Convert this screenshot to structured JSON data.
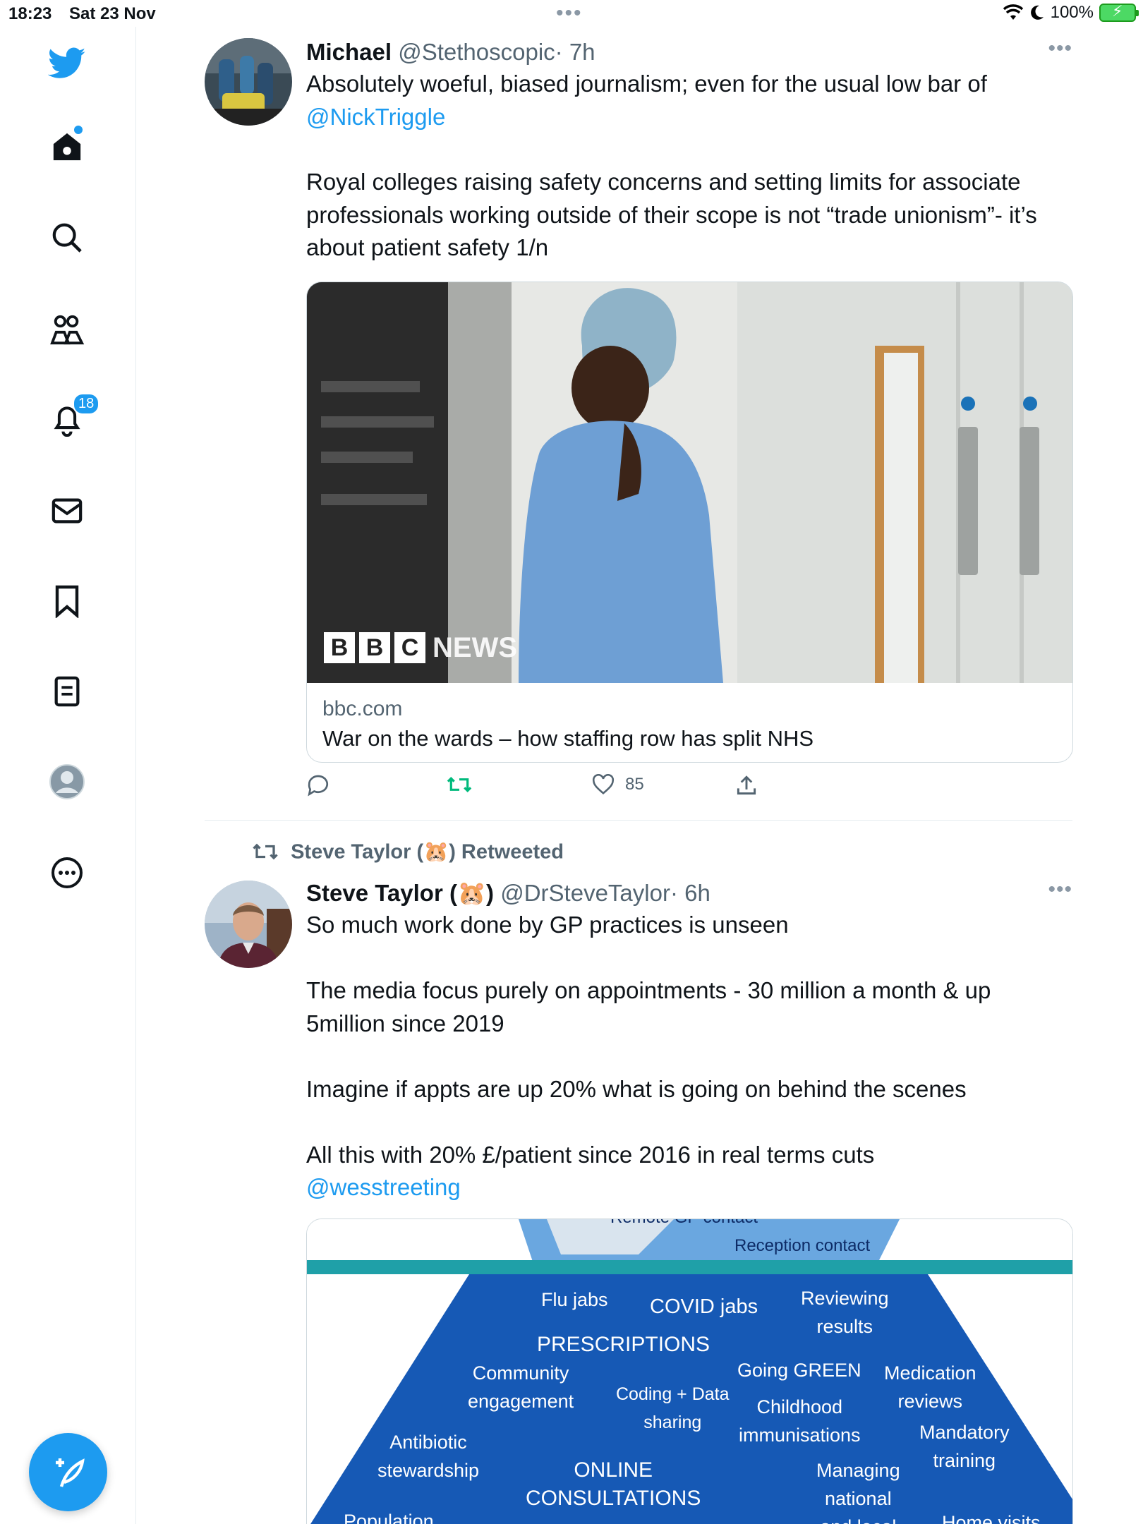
{
  "status_bar": {
    "time": "18:23",
    "date": "Sat 23 Nov",
    "battery": "100%"
  },
  "sidebar": {
    "notifications_count": "18"
  },
  "tweet1": {
    "name": "Michael",
    "handle": "@Stethoscopic",
    "time": "· 7h",
    "text_a": "Absolutely woeful, biased journalism; even for the usual low bar of",
    "mention": "@NickTriggle",
    "text_b": "Royal colleges raising safety concerns and setting limits for associate professionals working outside of their scope is not “trade unionism”- it’s about patient safety 1/n",
    "card": {
      "image_watermark": "NEWS",
      "domain": "bbc.com",
      "title": "War on the wards – how staffing row has split NHS"
    },
    "likes": "85"
  },
  "retweet": {
    "retweeted_by": "Steve Taylor (🐹) Retweeted"
  },
  "tweet2": {
    "name": "Steve Taylor (🐹)",
    "handle": "@DrSteveTaylor",
    "time": "· 6h",
    "text_a": "So much work done by GP practices is unseen\n\nThe media focus purely on appointments - 30 million a month & up 5million since 2019\n\nImagine if appts are up 20% what is going on behind the scenes\n\nAll this with 20% £/patient since 2016 in real terms cuts",
    "mention": "@wesstreeting",
    "iceberg": {
      "top_labels": [
        "Remote GP contact",
        "Reception contact"
      ],
      "labels": [
        "Flu jabs",
        "COVID jabs",
        "Reviewing\nresults",
        "PRESCRIPTIONS",
        "Going GREEN",
        "Medication\nreviews",
        "Community\nengagement",
        "Coding + Data\nsharing",
        "Childhood\nimmunisations",
        "Mandatory\ntraining",
        "Antibiotic\nstewardship",
        "ONLINE\nCONSULTATIONS",
        "Managing\nnational\nand local",
        "Population",
        "Home visits"
      ]
    }
  },
  "colors": {
    "accent": "#1d9bf0",
    "retweet_green": "#00ba7c",
    "text": "#0f1419",
    "muted": "#536471"
  }
}
